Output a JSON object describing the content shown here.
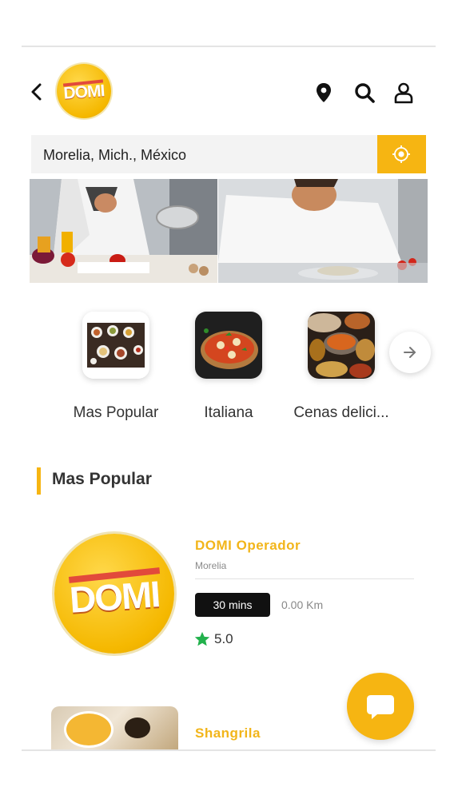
{
  "header": {
    "back_icon": "chevron-left-icon",
    "logo_text": "DOMI",
    "icons": [
      "map-pin-icon",
      "search-icon",
      "user-icon"
    ]
  },
  "location": {
    "value": "Morelia, Mich., México",
    "locate_icon": "crosshair-icon"
  },
  "banner": {
    "images": [
      "chef-mixing-bowl-photo",
      "chef-plating-dish-photo"
    ]
  },
  "categories": [
    {
      "label": "Mas Popular",
      "icon": "food-spread-thumbnail"
    },
    {
      "label": "Italiana",
      "icon": "pizza-thumbnail"
    },
    {
      "label": "Cenas delici...",
      "icon": "curry-dishes-thumbnail"
    }
  ],
  "categories_next_icon": "arrow-right-icon",
  "section": {
    "title": "Mas Popular"
  },
  "restaurants": [
    {
      "name": "DOMI Operador",
      "city": "Morelia",
      "logo_text": "DOMI",
      "time": "30 mins",
      "distance": "0.00 Km",
      "rating": "5.0"
    },
    {
      "name": "Shangrila",
      "image": "snacks-photo"
    }
  ],
  "colors": {
    "accent": "#f6b512",
    "title_yellow": "#f2b51a",
    "rating_star": "#22b14c"
  },
  "chat_icon": "chat-bubble-icon"
}
